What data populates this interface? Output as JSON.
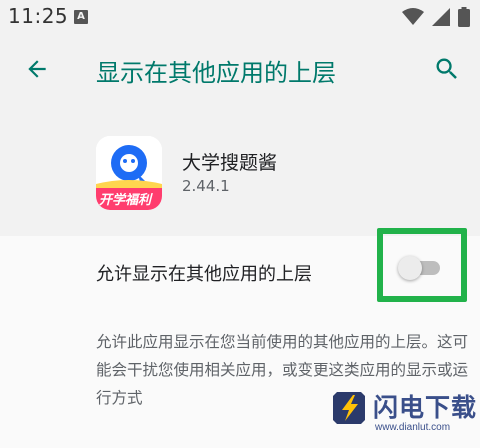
{
  "status_bar": {
    "time": "11:25",
    "notification_icon": "A",
    "icons": [
      "wifi-icon",
      "signal-icon",
      "battery-icon"
    ]
  },
  "app_bar": {
    "title": "显示在其他应用的上层",
    "back_icon": "arrow-back-icon",
    "search_icon": "search-icon"
  },
  "app": {
    "name": "大学搜题酱",
    "version": "2.44.1",
    "icon_badge": "开学福利"
  },
  "permission": {
    "label": "允许显示在其他应用的上层",
    "enabled": false
  },
  "description": "允许此应用显示在您当前使用的其他应用的上层。这可能会干扰您使用相关应用，或变更这类应用的显示或运行方式",
  "watermark": {
    "text": "闪电下载",
    "url": "www.dianlut.com"
  },
  "colors": {
    "accent": "#00796b",
    "highlight": "#21b24a",
    "background": "#f2f2f2",
    "content_bg": "#fafafa"
  }
}
